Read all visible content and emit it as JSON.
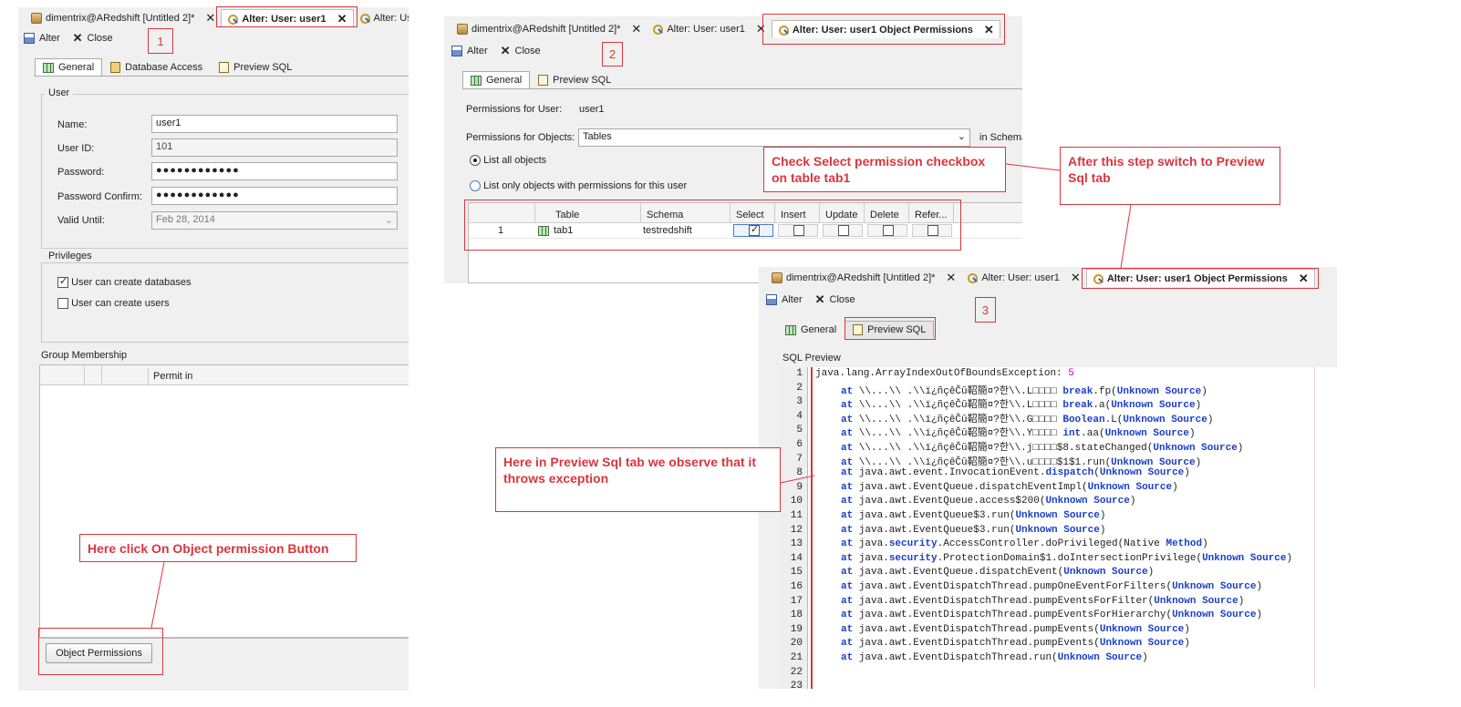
{
  "window1": {
    "tabs": [
      {
        "label": "dimentrix@ARedshift [Untitled 2]*",
        "icon": "database-icon"
      },
      {
        "label": "Alter: User: user1",
        "icon": "key-icon",
        "active": true
      },
      {
        "label": "Alter: Us",
        "icon": "key-icon"
      }
    ],
    "toolbar": {
      "alter": "Alter",
      "close": "Close"
    },
    "subtabs": [
      "General",
      "Database Access",
      "Preview SQL"
    ],
    "user_legend": "User",
    "fields": {
      "name_label": "Name:",
      "name_value": "user1",
      "userid_label": "User ID:",
      "userid_value": "101",
      "password_label": "Password:",
      "password_value": "●●●●●●●●●●●●",
      "confirm_label": "Password Confirm:",
      "confirm_value": "●●●●●●●●●●●●",
      "valid_label": "Valid Until:",
      "valid_value": "Feb 28, 2014"
    },
    "privileges_legend": "Privileges",
    "priv_create_db": "User can create databases",
    "priv_create_users": "User can create users",
    "group_label": "Group Membership",
    "group_col": "Permit in",
    "object_perm_button": "Object Permissions"
  },
  "window2": {
    "tabs": [
      {
        "label": "dimentrix@ARedshift [Untitled 2]*",
        "icon": "database-icon"
      },
      {
        "label": "Alter: User: user1",
        "icon": "key-icon"
      },
      {
        "label": "Alter: User: user1 Object Permissions",
        "icon": "key-icon",
        "active": true
      }
    ],
    "toolbar": {
      "alter": "Alter",
      "close": "Close"
    },
    "subtabs": [
      "General",
      "Preview SQL"
    ],
    "perm_user_label": "Permissions for User:",
    "perm_user_value": "user1",
    "perm_objects_label": "Permissions for Objects:",
    "perm_objects_value": "Tables",
    "in_schema": "in Schema",
    "radio_all": "List all objects",
    "radio_only": "List only objects with permissions for this user",
    "columns": [
      "Table",
      "Schema",
      "Select",
      "Insert",
      "Update",
      "Delete",
      "Refer..."
    ],
    "row": {
      "num": "1",
      "table": "tab1",
      "schema": "testredshift"
    }
  },
  "window3": {
    "tabs": [
      {
        "label": "dimentrix@ARedshift [Untitled 2]*",
        "icon": "database-icon"
      },
      {
        "label": "Alter: User: user1",
        "icon": "key-icon"
      },
      {
        "label": "Alter: User: user1 Object Permissions",
        "icon": "key-icon",
        "active": true
      }
    ],
    "toolbar": {
      "alter": "Alter",
      "close": "Close"
    },
    "subtabs": [
      "General",
      "Preview SQL"
    ],
    "sql_label": "SQL Preview",
    "code": [
      {
        "n": "1",
        "t": "java.lang.ArrayIndexOutOfBoundsException: ",
        "num": "5"
      },
      {
        "n": "2",
        "pre": "\\\\...\\\\ .\\\\ï¿ñçêČŭ鞀簡¤?한\\\\.L□□□□ ",
        "kw": "break",
        "post": ".fp(",
        "src": "Unknown Source",
        "end": ")"
      },
      {
        "n": "3",
        "pre": "\\\\...\\\\ .\\\\ï¿ñçêČŭ鞀簡¤?한\\\\.L□□□□ ",
        "kw": "break",
        "post": ".a(",
        "src": "Unknown Source",
        "end": ")"
      },
      {
        "n": "4",
        "pre": "\\\\...\\\\ .\\\\ï¿ñçêČŭ鞀簡¤?한\\\\.G□□□□ ",
        "kw": "Boolean",
        "post": ".L(",
        "src": "Unknown Source",
        "end": ")"
      },
      {
        "n": "5",
        "pre": "\\\\...\\\\ .\\\\ï¿ñçêČŭ鞀簡¤?한\\\\.Y□□□□ ",
        "kw": "int",
        "post": ".aa(",
        "src": "Unknown Source",
        "end": ")"
      },
      {
        "n": "6",
        "pre": "\\\\...\\\\ .\\\\ï¿ñçêČŭ鞀簡¤?한\\\\.j□□□□$8.stateChanged(",
        "src": "Unknown Source",
        "end": ")"
      },
      {
        "n": "7",
        "pre": "\\\\...\\\\ .\\\\ï¿ñçêČŭ鞀簡¤?한\\\\.u□□□□$1$1.run(",
        "src": "Unknown Source",
        "end": ")"
      },
      {
        "n": "8",
        "pre": "java.awt.event.InvocationEvent.",
        "kw": "dispatch",
        "post": "(",
        "src": "Unknown Source",
        "end": ")"
      },
      {
        "n": "9",
        "pre": "java.awt.EventQueue.dispatchEventImpl(",
        "src": "Unknown Source",
        "end": ")"
      },
      {
        "n": "10",
        "pre": "java.awt.EventQueue.access$200(",
        "src": "Unknown Source",
        "end": ")"
      },
      {
        "n": "11",
        "pre": "java.awt.EventQueue$3.run(",
        "src": "Unknown Source",
        "end": ")"
      },
      {
        "n": "12",
        "pre": "java.awt.EventQueue$3.run(",
        "src": "Unknown Source",
        "end": ")"
      },
      {
        "n": "13",
        "pre": "java.",
        "kw": "security",
        "post": ".AccessController.doPrivileged(Native ",
        "kw2": "Method",
        "end": ")"
      },
      {
        "n": "14",
        "pre": "java.",
        "kw": "security",
        "post": ".ProtectionDomain$1.doIntersectionPrivilege(",
        "src": "Unknown Source",
        "end": ")"
      },
      {
        "n": "15",
        "pre": "java.awt.EventQueue.dispatchEvent(",
        "src": "Unknown Source",
        "end": ")"
      },
      {
        "n": "16",
        "pre": "java.awt.EventDispatchThread.pumpOneEventForFilters(",
        "src": "Unknown Source",
        "end": ")"
      },
      {
        "n": "17",
        "pre": "java.awt.EventDispatchThread.pumpEventsForFilter(",
        "src": "Unknown Source",
        "end": ")"
      },
      {
        "n": "18",
        "pre": "java.awt.EventDispatchThread.pumpEventsForHierarchy(",
        "src": "Unknown Source",
        "end": ")"
      },
      {
        "n": "19",
        "pre": "java.awt.EventDispatchThread.pumpEvents(",
        "src": "Unknown Source",
        "end": ")"
      },
      {
        "n": "20",
        "pre": "java.awt.EventDispatchThread.pumpEvents(",
        "src": "Unknown Source",
        "end": ")"
      },
      {
        "n": "21",
        "pre": "java.awt.EventDispatchThread.run(",
        "src": "Unknown Source",
        "end": ")"
      },
      {
        "n": "22"
      },
      {
        "n": "23"
      }
    ],
    "at": "at"
  },
  "annotations": {
    "step1": "1",
    "step2": "2",
    "step3": "3",
    "click_object_perm": "Here click On Object permission Button",
    "check_select": "Check Select permission checkbox on table tab1",
    "switch_preview": "After this step switch to Preview Sql tab",
    "observe_exception": "Here in Preview Sql tab we observe that it throws exception"
  },
  "colors": {
    "annotation": "#d9363e",
    "keyword": "#1a3ec8",
    "number": "#c000c0"
  }
}
